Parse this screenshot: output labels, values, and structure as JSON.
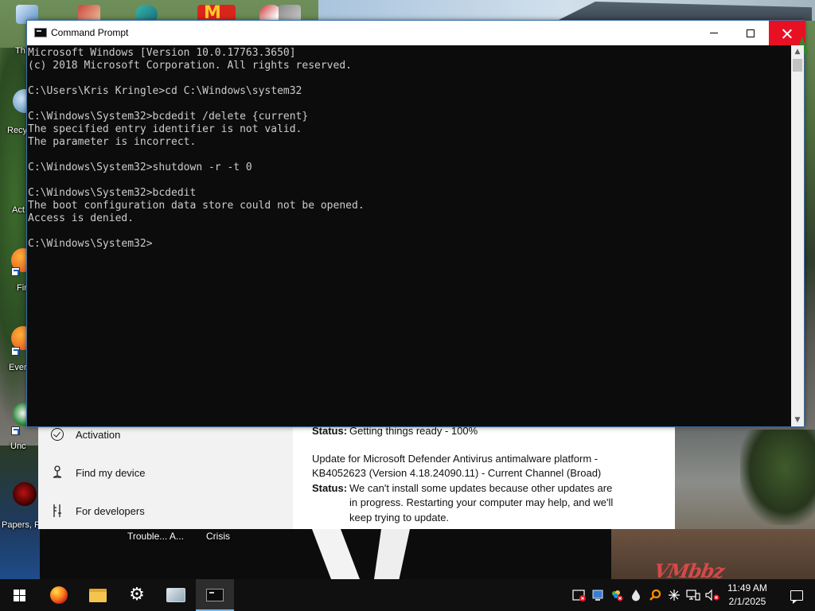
{
  "desktop": {
    "icon_labels": {
      "recycle": "Recy",
      "activate": "Act",
      "firefox": "Fir",
      "ever": "Ever",
      "uncl": "Unc",
      "papers": "Papers, P"
    },
    "top_left_label": "Th",
    "bottom_labels": [
      "Trouble... A...",
      "Crisis"
    ],
    "watermark": "VMbbz"
  },
  "cmd_window": {
    "title": "Command Prompt",
    "lines": [
      "Microsoft Windows [Version 10.0.17763.3650]",
      "(c) 2018 Microsoft Corporation. All rights reserved.",
      "",
      "C:\\Users\\Kris Kringle>cd C:\\Windows\\system32",
      "",
      "C:\\Windows\\System32>bcdedit /delete {current}",
      "The specified entry identifier is not valid.",
      "The parameter is incorrect.",
      "",
      "C:\\Windows\\System32>shutdown -r -t 0",
      "",
      "C:\\Windows\\System32>bcdedit",
      "The boot configuration data store could not be opened.",
      "Access is denied.",
      "",
      "C:\\Windows\\System32>"
    ]
  },
  "settings_window": {
    "nav": [
      {
        "label": "Activation",
        "icon": "circle-check-icon"
      },
      {
        "label": "Find my device",
        "icon": "person-pin-icon"
      },
      {
        "label": "For developers",
        "icon": "developer-tools-icon"
      }
    ],
    "update1_status_key": "Status:",
    "update1_status": "Getting things ready - 100%",
    "update2_title_line1": "Update for Microsoft Defender Antivirus antimalware platform -",
    "update2_title_line2": "KB4052623 (Version 4.18.24090.11) - Current Channel (Broad)",
    "update2_status_key": "Status:",
    "update2_status_line1": "We can't install some updates because other updates are",
    "update2_status_line2": "in progress. Restarting your computer may help, and we'll",
    "update2_status_line3": "keep trying to update."
  },
  "taskbar": {
    "apps": [
      "start-icon",
      "firefox-icon",
      "file-explorer-icon",
      "settings-gear-icon",
      "this-pc-icon",
      "command-prompt-icon"
    ],
    "tray_icons": [
      "security-warning-icon",
      "monitor-icon",
      "app-error-icon",
      "droplet-icon",
      "search-orange-icon",
      "sparkle-icon",
      "network-icon",
      "volume-muted-icon"
    ],
    "time": "11:49 AM",
    "date": "2/1/2025"
  },
  "colors": {
    "cmd_bg": "#0c0c0c",
    "cmd_text": "#cccccc",
    "close_red": "#e81123",
    "taskbar": "#101010",
    "accent": "#76b9ed"
  }
}
